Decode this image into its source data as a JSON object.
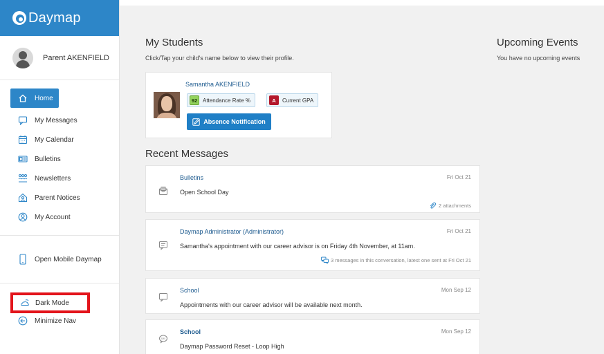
{
  "app": {
    "logo_text": "Daymap"
  },
  "profile": {
    "name": "Parent AKENFIELD"
  },
  "nav": {
    "items": [
      {
        "label": "Home",
        "icon": "home-icon",
        "active": true
      },
      {
        "label": "My Messages",
        "icon": "message-icon"
      },
      {
        "label": "My Calendar",
        "icon": "calendar-icon"
      },
      {
        "label": "Bulletins",
        "icon": "bulletin-icon"
      },
      {
        "label": "Newsletters",
        "icon": "newsletter-icon"
      },
      {
        "label": "Parent Notices",
        "icon": "notice-icon"
      },
      {
        "label": "My Account",
        "icon": "account-icon"
      }
    ],
    "mobile": "Open Mobile Daymap",
    "dark_mode": "Dark Mode",
    "minimize": "Minimize Nav"
  },
  "students": {
    "title": "My Students",
    "subtitle": "Click/Tap your child's name below to view their profile.",
    "card": {
      "name": "Samantha AKENFIELD",
      "attendance_value": "92",
      "attendance_label": "Attendance Rate %",
      "gpa_badge": "A",
      "gpa_label": "Current GPA",
      "absence_button": "Absence Notification"
    }
  },
  "messages": {
    "title": "Recent Messages",
    "items": [
      {
        "from": "Bulletins",
        "date": "Fri Oct 21",
        "text": "Open School Day",
        "meta": "2 attachments",
        "icon": "bulletin-message-icon"
      },
      {
        "from": "Daymap Administrator (Administrator)",
        "date": "Fri Oct 21",
        "text": "Samantha's appointment with our career advisor is on Friday 4th November, at 11am.",
        "meta": "3 messages in this conversation, latest one sent at Fri Oct 21",
        "icon": "chat-message-icon"
      },
      {
        "from": "School",
        "date": "Mon Sep 12",
        "text": "Appointments with our career advisor will be available next month.",
        "icon": "speech-bubble-icon"
      },
      {
        "from": "School",
        "date": "Mon Sep 12",
        "text": "Daymap Password Reset - Loop High",
        "icon": "sms-icon"
      }
    ]
  },
  "events": {
    "title": "Upcoming Events",
    "empty": "You have no upcoming events"
  },
  "colors": {
    "brand": "#2d86c8",
    "highlight_border": "#e3141b",
    "gpa_badge": "#b4182b",
    "attendance_badge": "#93d35d"
  }
}
